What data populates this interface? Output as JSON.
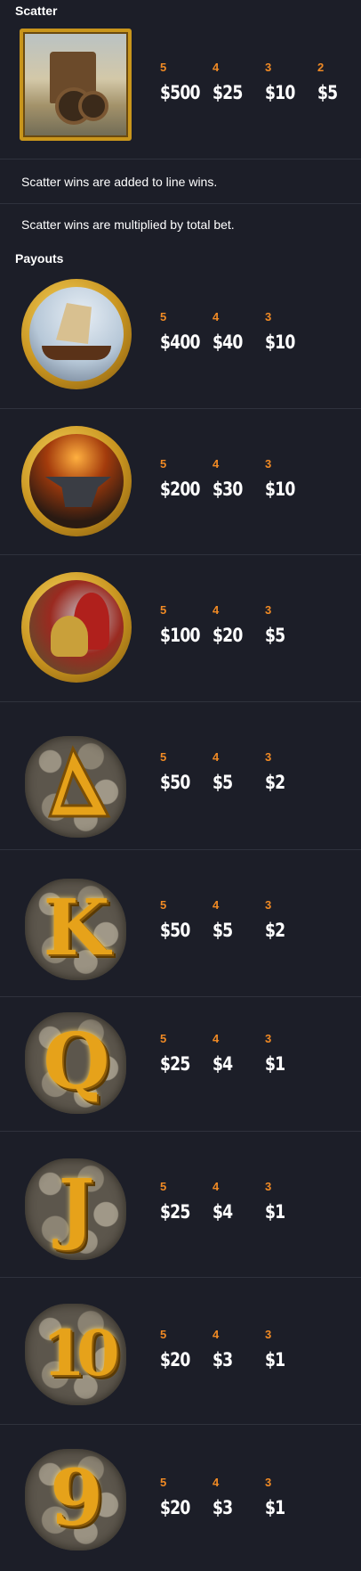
{
  "scatter": {
    "title": "Scatter",
    "icon": "catapult-scatter-symbol",
    "pays": [
      {
        "count": "5",
        "value": "$500"
      },
      {
        "count": "4",
        "value": "$25"
      },
      {
        "count": "3",
        "value": "$10"
      },
      {
        "count": "2",
        "value": "$5"
      }
    ],
    "notes": [
      "Scatter wins are added to line wins.",
      "Scatter wins are multiplied by total bet."
    ]
  },
  "payouts": {
    "title": "Payouts",
    "rows": [
      {
        "symbol": "ship-coin-symbol",
        "pays": [
          {
            "count": "5",
            "value": "$400"
          },
          {
            "count": "4",
            "value": "$40"
          },
          {
            "count": "3",
            "value": "$10"
          }
        ]
      },
      {
        "symbol": "anvil-coin-symbol",
        "pays": [
          {
            "count": "5",
            "value": "$200"
          },
          {
            "count": "4",
            "value": "$30"
          },
          {
            "count": "3",
            "value": "$10"
          }
        ]
      },
      {
        "symbol": "helmet-coin-symbol",
        "pays": [
          {
            "count": "5",
            "value": "$100"
          },
          {
            "count": "4",
            "value": "$20"
          },
          {
            "count": "3",
            "value": "$5"
          }
        ]
      },
      {
        "symbol": "a-stone-symbol",
        "pays": [
          {
            "count": "5",
            "value": "$50"
          },
          {
            "count": "4",
            "value": "$5"
          },
          {
            "count": "3",
            "value": "$2"
          }
        ]
      },
      {
        "symbol": "k-stone-symbol",
        "pays": [
          {
            "count": "5",
            "value": "$50"
          },
          {
            "count": "4",
            "value": "$5"
          },
          {
            "count": "3",
            "value": "$2"
          }
        ]
      },
      {
        "symbol": "q-stone-symbol",
        "pays": [
          {
            "count": "5",
            "value": "$25"
          },
          {
            "count": "4",
            "value": "$4"
          },
          {
            "count": "3",
            "value": "$1"
          }
        ]
      },
      {
        "symbol": "j-stone-symbol",
        "pays": [
          {
            "count": "5",
            "value": "$25"
          },
          {
            "count": "4",
            "value": "$4"
          },
          {
            "count": "3",
            "value": "$1"
          }
        ]
      },
      {
        "symbol": "ten-stone-symbol",
        "pays": [
          {
            "count": "5",
            "value": "$20"
          },
          {
            "count": "4",
            "value": "$3"
          },
          {
            "count": "3",
            "value": "$1"
          }
        ]
      },
      {
        "symbol": "nine-stone-symbol",
        "pays": [
          {
            "count": "5",
            "value": "$20"
          },
          {
            "count": "4",
            "value": "$3"
          },
          {
            "count": "3",
            "value": "$1"
          }
        ]
      }
    ]
  },
  "colors": {
    "background": "#1c1e28",
    "count_accent": "#f08a24",
    "gold": "#e6a21a"
  }
}
